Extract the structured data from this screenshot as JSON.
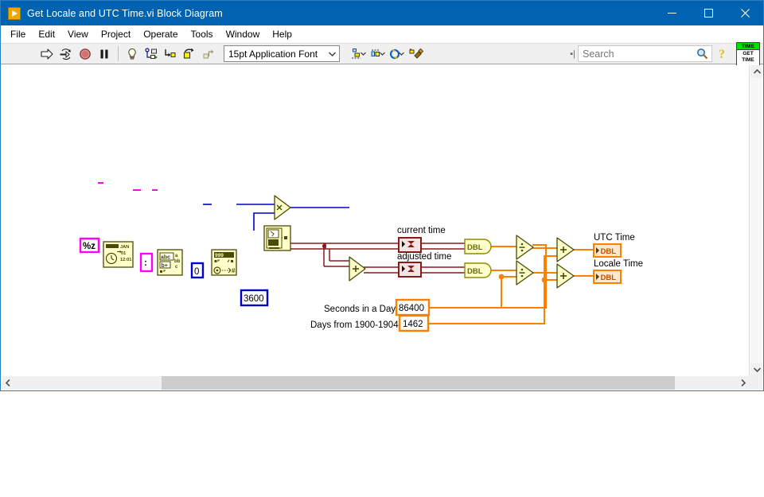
{
  "window": {
    "title": "Get Locale and UTC Time.vi Block Diagram",
    "icon": "labview-vi-icon",
    "buttons": {
      "minimize": "minimize-icon",
      "maximize": "maximize-icon",
      "close": "close-icon"
    }
  },
  "menu": {
    "items": [
      {
        "label": "File"
      },
      {
        "label": "Edit"
      },
      {
        "label": "View"
      },
      {
        "label": "Project"
      },
      {
        "label": "Operate"
      },
      {
        "label": "Tools"
      },
      {
        "label": "Window"
      },
      {
        "label": "Help"
      }
    ]
  },
  "toolbar": {
    "run": "run-arrow-icon",
    "run_continuously": "run-continuously-icon",
    "abort": "abort-execution-icon",
    "pause": "pause-icon",
    "highlight_execution": "lightbulb-icon",
    "retain_wire_values": "retain-wire-values-icon",
    "step_into": "step-into-icon",
    "step_over": "step-over-icon",
    "step_out": "step-out-icon",
    "font": {
      "label": "15pt Application Font",
      "arrow": "chevron-down-icon"
    },
    "align_objects": "align-objects-icon",
    "distribute_objects": "distribute-objects-icon",
    "resize_objects": "resize-objects-icon",
    "reorder": "reorder-icon",
    "clean_up_diagram": "clean-up-diagram-icon",
    "search": {
      "grip": "search-resize-grip",
      "placeholder": "Search",
      "value": "",
      "icon": "magnifier-icon"
    },
    "help": "context-help-icon",
    "vi_icon": {
      "top_label": "TIME",
      "body_line1": "GET",
      "body_line2": "TIME"
    }
  },
  "diagram": {
    "labels": {
      "current_time": "current time",
      "adjusted_time": "adjusted time",
      "utc_time": "UTC Time",
      "locale_time": "Locale Time",
      "seconds_in_a_day": "Seconds in a Day",
      "days_from_1900_1904": "Days from 1900-1904"
    },
    "constants": {
      "format_string": "%z",
      "colon_separator": ":",
      "zero": "0",
      "seconds_per_hour": "3600",
      "seconds_in_a_day": "86400",
      "days_offset": "1462"
    },
    "terminals": {
      "current_time_type": "DBL",
      "adjusted_time_type": "DBL",
      "utc_time_type": "DBL",
      "locale_time_type": "DBL"
    },
    "functions": {
      "format_date_time_string": "format-date-time-string-node",
      "scan_from_string": "scan-from-string-node",
      "number_to_decimal_string": "number-to-decimal-string-node",
      "get_date_time_in_seconds": "get-date-time-in-seconds-node",
      "multiply": "multiply-node",
      "add_offset": "add-node",
      "divide_1": "divide-node",
      "divide_2": "divide-node",
      "add_1": "add-node",
      "add_2": "add-node",
      "to_double_1": "to-double-precision-node",
      "to_double_2": "to-double-precision-node"
    },
    "colors": {
      "wire_orange": "#ff7f00",
      "wire_blue": "#0000c8",
      "wire_timestamp": "#8b1a1a",
      "wire_string": "#ff00ff",
      "node_fill": "#ffffcc",
      "node_stroke": "#4a4a00"
    }
  },
  "scrollbars": {
    "vertical": {
      "up": "chevron-up-icon",
      "down": "chevron-down-icon"
    },
    "horizontal": {
      "left": "chevron-left-icon",
      "right": "chevron-right-icon"
    }
  }
}
